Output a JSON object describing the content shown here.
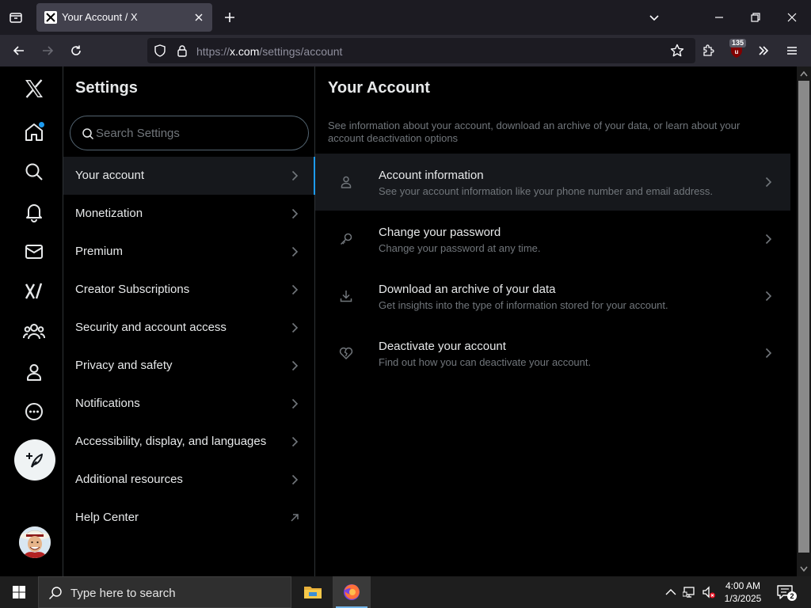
{
  "browser": {
    "tab_title": "Your Account / X",
    "url_prefix": "https://",
    "url_host": "x.com",
    "url_path": "/settings/account",
    "extension_badge": "135"
  },
  "x_nav": {
    "items": [
      "x-logo-icon",
      "home-icon",
      "search-icon",
      "bell-icon",
      "mail-icon",
      "grok-icon",
      "communities-icon",
      "profile-icon",
      "more-icon"
    ],
    "notification_dot_color": "#1d9bf0",
    "accent": "#1d9bf0"
  },
  "settings": {
    "title": "Settings",
    "search_placeholder": "Search Settings",
    "items": [
      {
        "label": "Your account",
        "active": true
      },
      {
        "label": "Monetization"
      },
      {
        "label": "Premium"
      },
      {
        "label": "Creator Subscriptions"
      },
      {
        "label": "Security and account access"
      },
      {
        "label": "Privacy and safety"
      },
      {
        "label": "Notifications"
      },
      {
        "label": "Accessibility, display, and languages"
      },
      {
        "label": "Additional resources"
      },
      {
        "label": "Help Center",
        "external": true
      }
    ]
  },
  "account": {
    "title": "Your Account",
    "description": "See information about your account, download an archive of your data, or learn about your account deactivation options",
    "items": [
      {
        "label": "Account information",
        "sub": "See your account information like your phone number and email address.",
        "icon": "person-icon"
      },
      {
        "label": "Change your password",
        "sub": "Change your password at any time.",
        "icon": "key-icon"
      },
      {
        "label": "Download an archive of your data",
        "sub": "Get insights into the type of information stored for your account.",
        "icon": "download-icon"
      },
      {
        "label": "Deactivate your account",
        "sub": "Find out how you can deactivate your account.",
        "icon": "broken-heart-icon"
      }
    ]
  },
  "taskbar": {
    "search_placeholder": "Type here to search",
    "time": "4:00 AM",
    "date": "1/3/2025",
    "notification_count": "2"
  }
}
